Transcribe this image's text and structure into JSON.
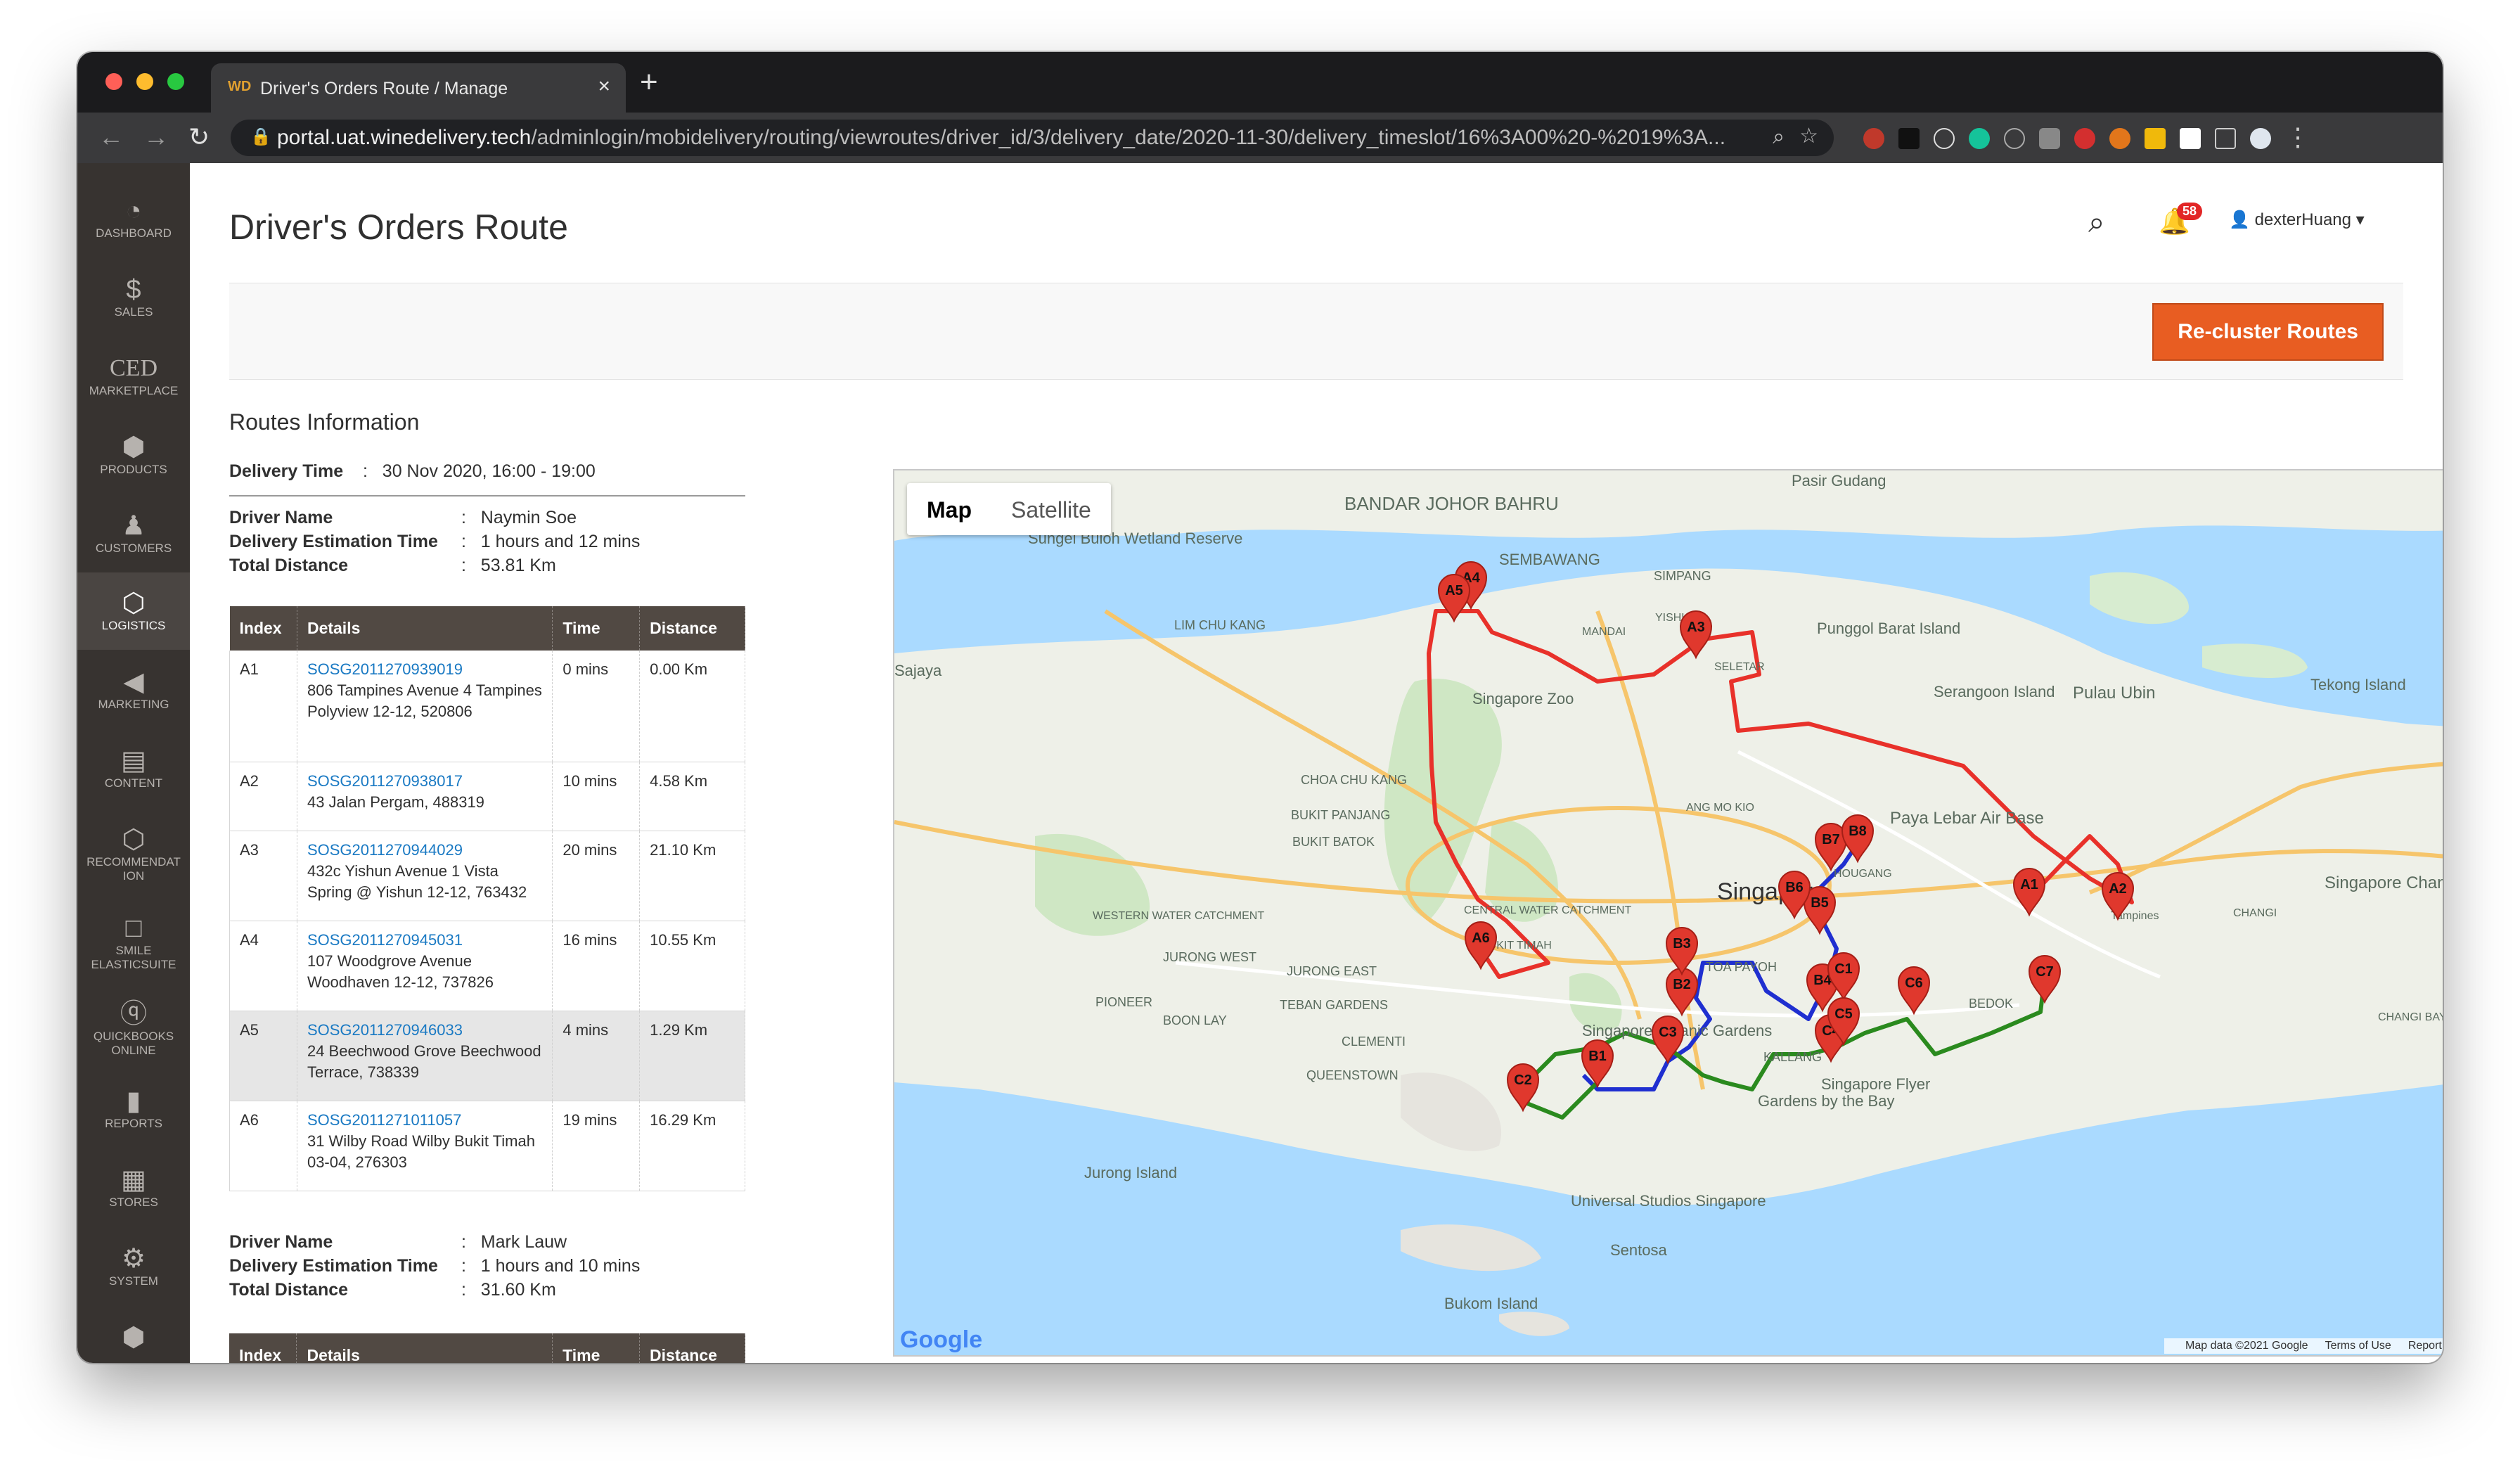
{
  "browser": {
    "tab_title": "Driver's Orders Route / Manage",
    "tab_favicon": "WD",
    "url_host": "portal.uat.winedelivery.tech",
    "url_path": "/adminlogin/mobidelivery/routing/viewroutes/driver_id/3/delivery_date/2020-11-30/delivery_timeslot/16%3A00%20-%2019%3A..."
  },
  "sidebar": {
    "items": [
      {
        "label": "DASHBOARD",
        "icon": "◔"
      },
      {
        "label": "SALES",
        "icon": "$"
      },
      {
        "label": "MARKETPLACE",
        "icon": "CED"
      },
      {
        "label": "PRODUCTS",
        "icon": "⬢"
      },
      {
        "label": "CUSTOMERS",
        "icon": "♟"
      },
      {
        "label": "LOGISTICS",
        "icon": "⬡"
      },
      {
        "label": "MARKETING",
        "icon": "◀"
      },
      {
        "label": "CONTENT",
        "icon": "▤"
      },
      {
        "label": "RECOMMENDAT ION",
        "icon": "⬡"
      },
      {
        "label": "SMILE ELASTICSUITE",
        "icon": "□"
      },
      {
        "label": "QUICKBOOKS ONLINE",
        "icon": "ⓠ"
      },
      {
        "label": "REPORTS",
        "icon": "▮"
      },
      {
        "label": "STORES",
        "icon": "▦"
      },
      {
        "label": "SYSTEM",
        "icon": "⚙"
      },
      {
        "label": "",
        "icon": "⬢"
      }
    ]
  },
  "header": {
    "title": "Driver's Orders Route",
    "notifications": "58",
    "user": "dexterHuang"
  },
  "actions": {
    "recluster": "Re-cluster Routes"
  },
  "routes": {
    "heading": "Routes Information",
    "delivery_time_label": "Delivery Time",
    "delivery_time": "30 Nov 2020, 16:00 - 19:00",
    "labels": {
      "driver": "Driver Name",
      "est": "Delivery Estimation Time",
      "dist": "Total Distance"
    },
    "columns": [
      "Index",
      "Details",
      "Time",
      "Distance"
    ],
    "drivers": [
      {
        "name": "Naymin Soe",
        "estimation": "1 hours and 12 mins",
        "distance": "53.81 Km",
        "rows": [
          {
            "index": "A1",
            "order": "SOSG2011270939019",
            "address": "806 Tampines Avenue 4 Tampines Polyview 12-12, 520806",
            "time": "0 mins",
            "distance": "0.00 Km"
          },
          {
            "index": "A2",
            "order": "SOSG2011270938017",
            "address": "43 Jalan Pergam, 488319",
            "time": "10 mins",
            "distance": "4.58 Km"
          },
          {
            "index": "A3",
            "order": "SOSG2011270944029",
            "address": "432c Yishun Avenue 1 Vista Spring @ Yishun 12-12, 763432",
            "time": "20 mins",
            "distance": "21.10 Km"
          },
          {
            "index": "A4",
            "order": "SOSG2011270945031",
            "address": "107 Woodgrove Avenue Woodhaven 12-12, 737826",
            "time": "16 mins",
            "distance": "10.55 Km"
          },
          {
            "index": "A5",
            "order": "SOSG2011270946033",
            "address": "24 Beechwood Grove Beechwood Terrace, 738339",
            "time": "4 mins",
            "distance": "1.29 Km"
          },
          {
            "index": "A6",
            "order": "SOSG2011271011057",
            "address": "31 Wilby Road Wilby Bukit Timah 03-04, 276303",
            "time": "19 mins",
            "distance": "16.29 Km"
          }
        ]
      },
      {
        "name": "Mark Lauw",
        "estimation": "1 hours and 10 mins",
        "distance": "31.60 Km",
        "rows": []
      }
    ]
  },
  "map": {
    "type_map": "Map",
    "type_satellite": "Satellite",
    "attribution": "Map data ©2021 Google",
    "terms": "Terms of Use",
    "report": "Report a map error",
    "logo": "Google",
    "zoom_in": "+",
    "zoom_out": "−",
    "center_label": "Singapore",
    "place_labels": [
      "BANDAR JOHOR BAHRU",
      "Sungei Buloh Wetland Reserve",
      "SEMBAWANG",
      "SIMPANG",
      "Punggol Barat Island",
      "Serangoon Island",
      "Pulau Ubin",
      "Tekong Island",
      "Singapore Zoo",
      "LIM CHU KANG",
      "CHOA CHU KANG",
      "BUKIT PANJANG",
      "BUKIT BATOK",
      "Paya Lebar Air Base",
      "Singapore Changi Airport",
      "WESTERN WATER CATCHMENT",
      "JURONG WEST",
      "JURONG EAST",
      "PIONEER",
      "TEBAN GARDENS",
      "BOON LAY",
      "Singapore Botanic Gardens",
      "TOA PAYOH",
      "KALLANG",
      "Singapore Flyer",
      "Gardens by the Bay",
      "Jurong Island",
      "Universal Studios Singapore",
      "Sentosa",
      "Bukom Island",
      "CHANGI BAY",
      "BEDOK",
      "MANDAI",
      "YISHUN",
      "SELETAR",
      "HOUGANG",
      "ANG MO KIO",
      "CENTRAL WATER CATCHMENT",
      "BUKIT TIMAH",
      "QUEENSTOWN",
      "CLEMENTI",
      "CHANGI",
      "Pasir Gudang",
      "Tampines",
      "Sajaya"
    ],
    "route_colors": {
      "A": "#e8312a",
      "B": "#1f2fd0",
      "C": "#2a8a1e"
    },
    "markers": [
      "A1",
      "A2",
      "A3",
      "A4",
      "A5",
      "A6",
      "B1",
      "B2",
      "B3",
      "B4",
      "B5",
      "B6",
      "B7",
      "B8",
      "C1",
      "C2",
      "C3",
      "C4",
      "C5",
      "C6",
      "C7"
    ]
  }
}
